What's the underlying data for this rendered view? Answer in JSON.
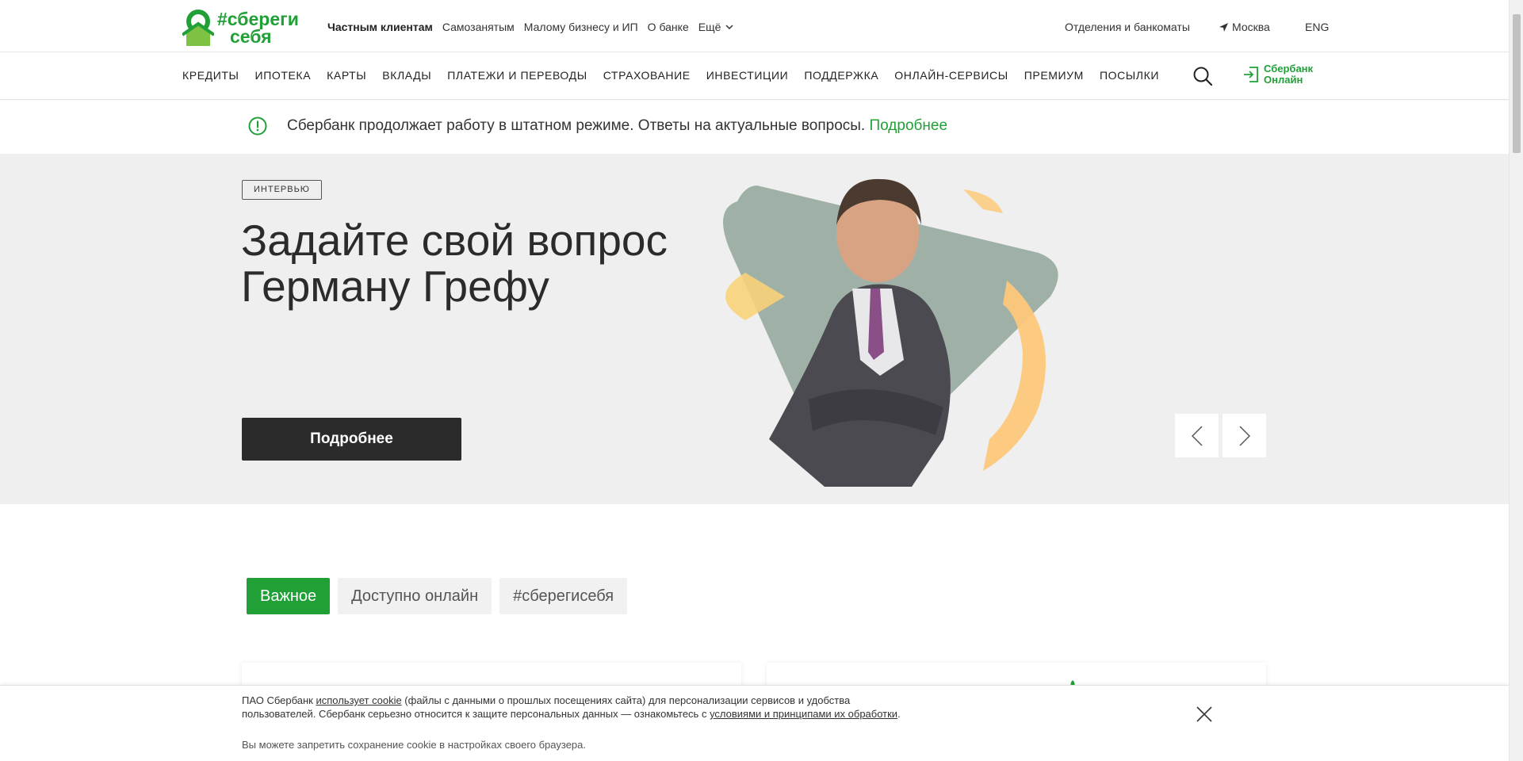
{
  "brand": {
    "logo_line1": "#сбереги",
    "logo_line2": "себя",
    "green": "#21a038"
  },
  "top_nav": {
    "items": [
      "Частным клиентам",
      "Самозанятым",
      "Малому бизнесу и ИП",
      "О банке"
    ],
    "more_label": "Ещё",
    "branches_label": "Отделения и банкоматы",
    "city": "Москва",
    "lang": "ENG"
  },
  "main_nav": {
    "items": [
      "КРЕДИТЫ",
      "ИПОТЕКА",
      "КАРТЫ",
      "ВКЛАДЫ",
      "ПЛАТЕЖИ И ПЕРЕВОДЫ",
      "СТРАХОВАНИЕ",
      "ИНВЕСТИЦИИ",
      "ПОДДЕРЖКА",
      "ОНЛАЙН-СЕРВИСЫ",
      "ПРЕМИУМ",
      "ПОСЫЛКИ"
    ],
    "sbol_line1": "Сбербанк",
    "sbol_line2": "Онлайн"
  },
  "notice": {
    "text": "Сбербанк продолжает работу в штатном режиме. Ответы на актуальные вопросы.",
    "link": "Подробнее"
  },
  "hero": {
    "tag": "ИНТЕРВЬЮ",
    "title_line1": "Задайте свой вопрос",
    "title_line2": "Герману Грефу",
    "cta": "Подробнее",
    "bg_color": "#efefef"
  },
  "tabs": [
    "Важное",
    "Доступно онлайн",
    "#сберегисебя"
  ],
  "cookie": {
    "t1": "ПАО Сбербанк ",
    "link1": "использует cookie",
    "t2": " (файлы с данными о прошлых посещениях сайта) для персонализации сервисов и удобства пользователей. Сбербанк серьезно относится к защите персональных данных — ознакомьтесь с ",
    "link2": "условиями и принципами их обработки",
    "t3": ".",
    "note": "Вы можете запретить сохранение cookie в настройках своего браузера."
  }
}
